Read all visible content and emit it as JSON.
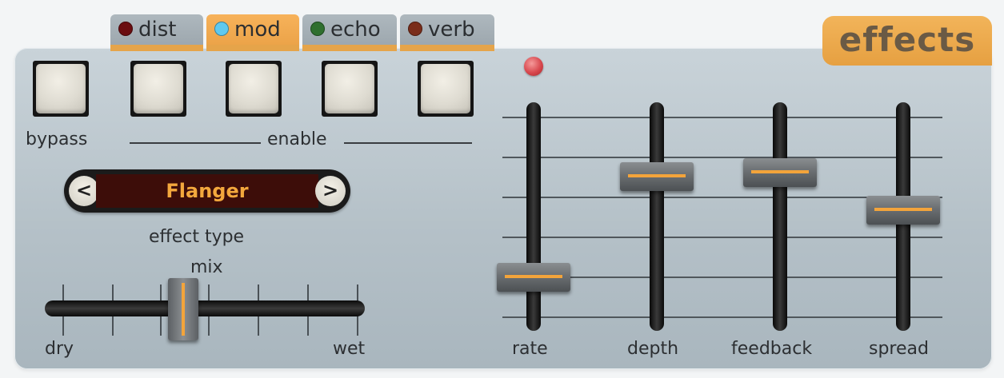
{
  "tabs": [
    {
      "label": "dist",
      "led_color": "#6b0d10",
      "active": false
    },
    {
      "label": "mod",
      "led_color": "#5fc9ef",
      "active": true
    },
    {
      "label": "echo",
      "led_color": "#2f6f2e",
      "active": false
    },
    {
      "label": "verb",
      "led_color": "#7a2d1a",
      "active": false
    }
  ],
  "header": {
    "title": "effects"
  },
  "buttons": {
    "bypass_label": "bypass",
    "enable_label": "enable"
  },
  "effect_type": {
    "label": "effect type",
    "value": "Flanger",
    "prev": "<",
    "next": ">"
  },
  "mix": {
    "label": "mix",
    "min_label": "dry",
    "max_label": "wet",
    "level": 0.43
  },
  "faders": [
    {
      "label": "rate",
      "level": 0.18
    },
    {
      "label": "depth",
      "level": 0.66
    },
    {
      "label": "feedback",
      "level": 0.68
    },
    {
      "label": "spread",
      "level": 0.5
    }
  ],
  "colors": {
    "accent": "#e9a045",
    "display_text": "#f3a83d",
    "display_bg": "#3d0d09",
    "rate_led": "#d8484e"
  }
}
